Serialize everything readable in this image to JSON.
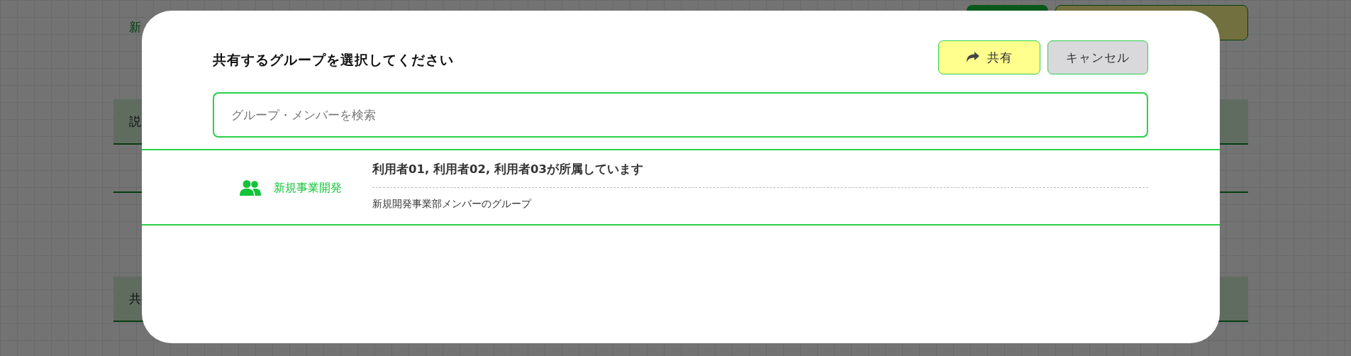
{
  "background": {
    "title": "新",
    "buttons": [
      {
        "kind": "primary"
      },
      {
        "kind": "secondary"
      }
    ],
    "sections": [
      {
        "label": "説"
      },
      {
        "label": "共"
      }
    ]
  },
  "dialog": {
    "title": "共有するグループを選択してください",
    "buttons": [
      {
        "label": "共有",
        "kind": "share"
      },
      {
        "label": "キャンセル",
        "kind": "cancel"
      }
    ],
    "search": {
      "placeholder": "グループ・メンバーを検索"
    },
    "groups": [
      {
        "name": "新規事業開発",
        "members": "利用者01, 利用者02, 利用者03が所属しています",
        "description": "新規開発事業部メンバーのグループ"
      }
    ]
  }
}
